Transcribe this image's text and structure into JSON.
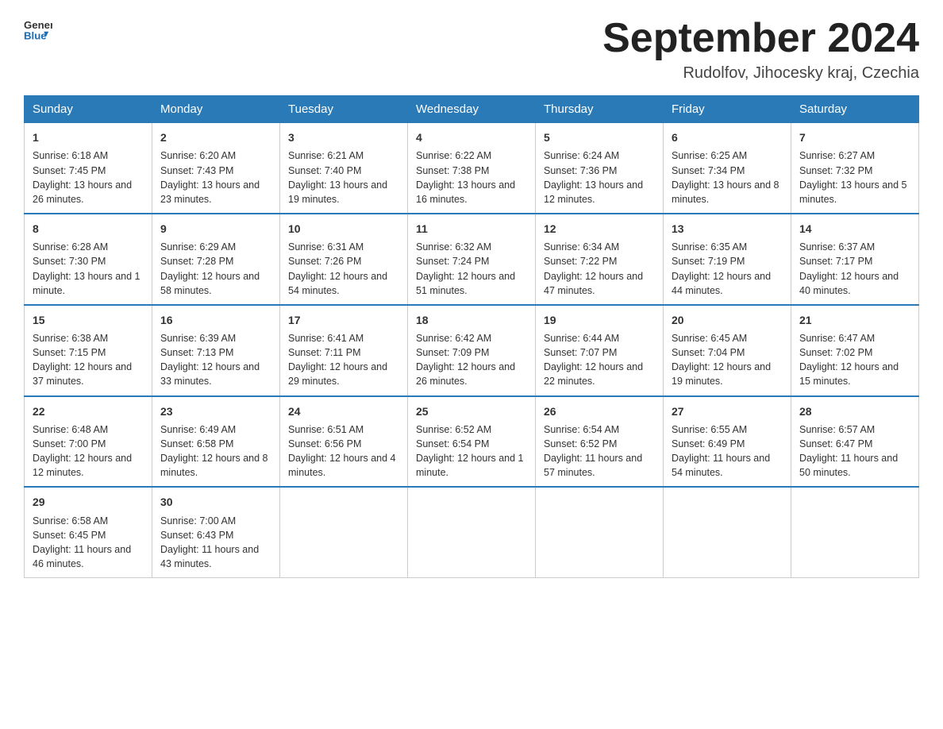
{
  "header": {
    "logo_general": "General",
    "logo_blue": "Blue",
    "title": "September 2024",
    "location": "Rudolfov, Jihocesky kraj, Czechia"
  },
  "days_of_week": [
    "Sunday",
    "Monday",
    "Tuesday",
    "Wednesday",
    "Thursday",
    "Friday",
    "Saturday"
  ],
  "weeks": [
    [
      {
        "date": "1",
        "sunrise": "Sunrise: 6:18 AM",
        "sunset": "Sunset: 7:45 PM",
        "daylight": "Daylight: 13 hours and 26 minutes."
      },
      {
        "date": "2",
        "sunrise": "Sunrise: 6:20 AM",
        "sunset": "Sunset: 7:43 PM",
        "daylight": "Daylight: 13 hours and 23 minutes."
      },
      {
        "date": "3",
        "sunrise": "Sunrise: 6:21 AM",
        "sunset": "Sunset: 7:40 PM",
        "daylight": "Daylight: 13 hours and 19 minutes."
      },
      {
        "date": "4",
        "sunrise": "Sunrise: 6:22 AM",
        "sunset": "Sunset: 7:38 PM",
        "daylight": "Daylight: 13 hours and 16 minutes."
      },
      {
        "date": "5",
        "sunrise": "Sunrise: 6:24 AM",
        "sunset": "Sunset: 7:36 PM",
        "daylight": "Daylight: 13 hours and 12 minutes."
      },
      {
        "date": "6",
        "sunrise": "Sunrise: 6:25 AM",
        "sunset": "Sunset: 7:34 PM",
        "daylight": "Daylight: 13 hours and 8 minutes."
      },
      {
        "date": "7",
        "sunrise": "Sunrise: 6:27 AM",
        "sunset": "Sunset: 7:32 PM",
        "daylight": "Daylight: 13 hours and 5 minutes."
      }
    ],
    [
      {
        "date": "8",
        "sunrise": "Sunrise: 6:28 AM",
        "sunset": "Sunset: 7:30 PM",
        "daylight": "Daylight: 13 hours and 1 minute."
      },
      {
        "date": "9",
        "sunrise": "Sunrise: 6:29 AM",
        "sunset": "Sunset: 7:28 PM",
        "daylight": "Daylight: 12 hours and 58 minutes."
      },
      {
        "date": "10",
        "sunrise": "Sunrise: 6:31 AM",
        "sunset": "Sunset: 7:26 PM",
        "daylight": "Daylight: 12 hours and 54 minutes."
      },
      {
        "date": "11",
        "sunrise": "Sunrise: 6:32 AM",
        "sunset": "Sunset: 7:24 PM",
        "daylight": "Daylight: 12 hours and 51 minutes."
      },
      {
        "date": "12",
        "sunrise": "Sunrise: 6:34 AM",
        "sunset": "Sunset: 7:22 PM",
        "daylight": "Daylight: 12 hours and 47 minutes."
      },
      {
        "date": "13",
        "sunrise": "Sunrise: 6:35 AM",
        "sunset": "Sunset: 7:19 PM",
        "daylight": "Daylight: 12 hours and 44 minutes."
      },
      {
        "date": "14",
        "sunrise": "Sunrise: 6:37 AM",
        "sunset": "Sunset: 7:17 PM",
        "daylight": "Daylight: 12 hours and 40 minutes."
      }
    ],
    [
      {
        "date": "15",
        "sunrise": "Sunrise: 6:38 AM",
        "sunset": "Sunset: 7:15 PM",
        "daylight": "Daylight: 12 hours and 37 minutes."
      },
      {
        "date": "16",
        "sunrise": "Sunrise: 6:39 AM",
        "sunset": "Sunset: 7:13 PM",
        "daylight": "Daylight: 12 hours and 33 minutes."
      },
      {
        "date": "17",
        "sunrise": "Sunrise: 6:41 AM",
        "sunset": "Sunset: 7:11 PM",
        "daylight": "Daylight: 12 hours and 29 minutes."
      },
      {
        "date": "18",
        "sunrise": "Sunrise: 6:42 AM",
        "sunset": "Sunset: 7:09 PM",
        "daylight": "Daylight: 12 hours and 26 minutes."
      },
      {
        "date": "19",
        "sunrise": "Sunrise: 6:44 AM",
        "sunset": "Sunset: 7:07 PM",
        "daylight": "Daylight: 12 hours and 22 minutes."
      },
      {
        "date": "20",
        "sunrise": "Sunrise: 6:45 AM",
        "sunset": "Sunset: 7:04 PM",
        "daylight": "Daylight: 12 hours and 19 minutes."
      },
      {
        "date": "21",
        "sunrise": "Sunrise: 6:47 AM",
        "sunset": "Sunset: 7:02 PM",
        "daylight": "Daylight: 12 hours and 15 minutes."
      }
    ],
    [
      {
        "date": "22",
        "sunrise": "Sunrise: 6:48 AM",
        "sunset": "Sunset: 7:00 PM",
        "daylight": "Daylight: 12 hours and 12 minutes."
      },
      {
        "date": "23",
        "sunrise": "Sunrise: 6:49 AM",
        "sunset": "Sunset: 6:58 PM",
        "daylight": "Daylight: 12 hours and 8 minutes."
      },
      {
        "date": "24",
        "sunrise": "Sunrise: 6:51 AM",
        "sunset": "Sunset: 6:56 PM",
        "daylight": "Daylight: 12 hours and 4 minutes."
      },
      {
        "date": "25",
        "sunrise": "Sunrise: 6:52 AM",
        "sunset": "Sunset: 6:54 PM",
        "daylight": "Daylight: 12 hours and 1 minute."
      },
      {
        "date": "26",
        "sunrise": "Sunrise: 6:54 AM",
        "sunset": "Sunset: 6:52 PM",
        "daylight": "Daylight: 11 hours and 57 minutes."
      },
      {
        "date": "27",
        "sunrise": "Sunrise: 6:55 AM",
        "sunset": "Sunset: 6:49 PM",
        "daylight": "Daylight: 11 hours and 54 minutes."
      },
      {
        "date": "28",
        "sunrise": "Sunrise: 6:57 AM",
        "sunset": "Sunset: 6:47 PM",
        "daylight": "Daylight: 11 hours and 50 minutes."
      }
    ],
    [
      {
        "date": "29",
        "sunrise": "Sunrise: 6:58 AM",
        "sunset": "Sunset: 6:45 PM",
        "daylight": "Daylight: 11 hours and 46 minutes."
      },
      {
        "date": "30",
        "sunrise": "Sunrise: 7:00 AM",
        "sunset": "Sunset: 6:43 PM",
        "daylight": "Daylight: 11 hours and 43 minutes."
      },
      {
        "date": "",
        "sunrise": "",
        "sunset": "",
        "daylight": ""
      },
      {
        "date": "",
        "sunrise": "",
        "sunset": "",
        "daylight": ""
      },
      {
        "date": "",
        "sunrise": "",
        "sunset": "",
        "daylight": ""
      },
      {
        "date": "",
        "sunrise": "",
        "sunset": "",
        "daylight": ""
      },
      {
        "date": "",
        "sunrise": "",
        "sunset": "",
        "daylight": ""
      }
    ]
  ]
}
